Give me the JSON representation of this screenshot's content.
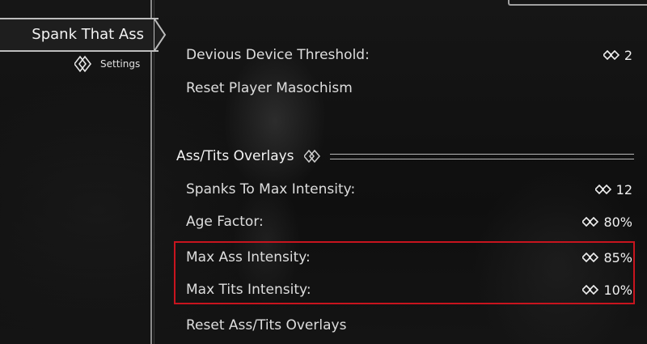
{
  "left_menu": {
    "mod_name": "Spank That Ass",
    "items": [
      {
        "label": "Settings",
        "icon": "mcm-diamond-icon"
      }
    ]
  },
  "options": {
    "devious_threshold": {
      "label": "Devious Device Threshold:",
      "value": "2"
    },
    "reset_masochism": {
      "label": "Reset Player Masochism"
    },
    "section_header": "Ass/Tits Overlays",
    "spanks_to_max": {
      "label": "Spanks To Max Intensity:",
      "value": "12"
    },
    "age_factor": {
      "label": "Age Factor:",
      "value": "80%"
    },
    "max_ass": {
      "label": "Max Ass Intensity:",
      "value": "85%"
    },
    "max_tits": {
      "label": "Max Tits Intensity:",
      "value": "10%"
    },
    "reset_overlays": {
      "label": "Reset Ass/Tits Overlays"
    }
  },
  "colors": {
    "highlight": "#c8141e",
    "text": "#e6e6e6"
  }
}
